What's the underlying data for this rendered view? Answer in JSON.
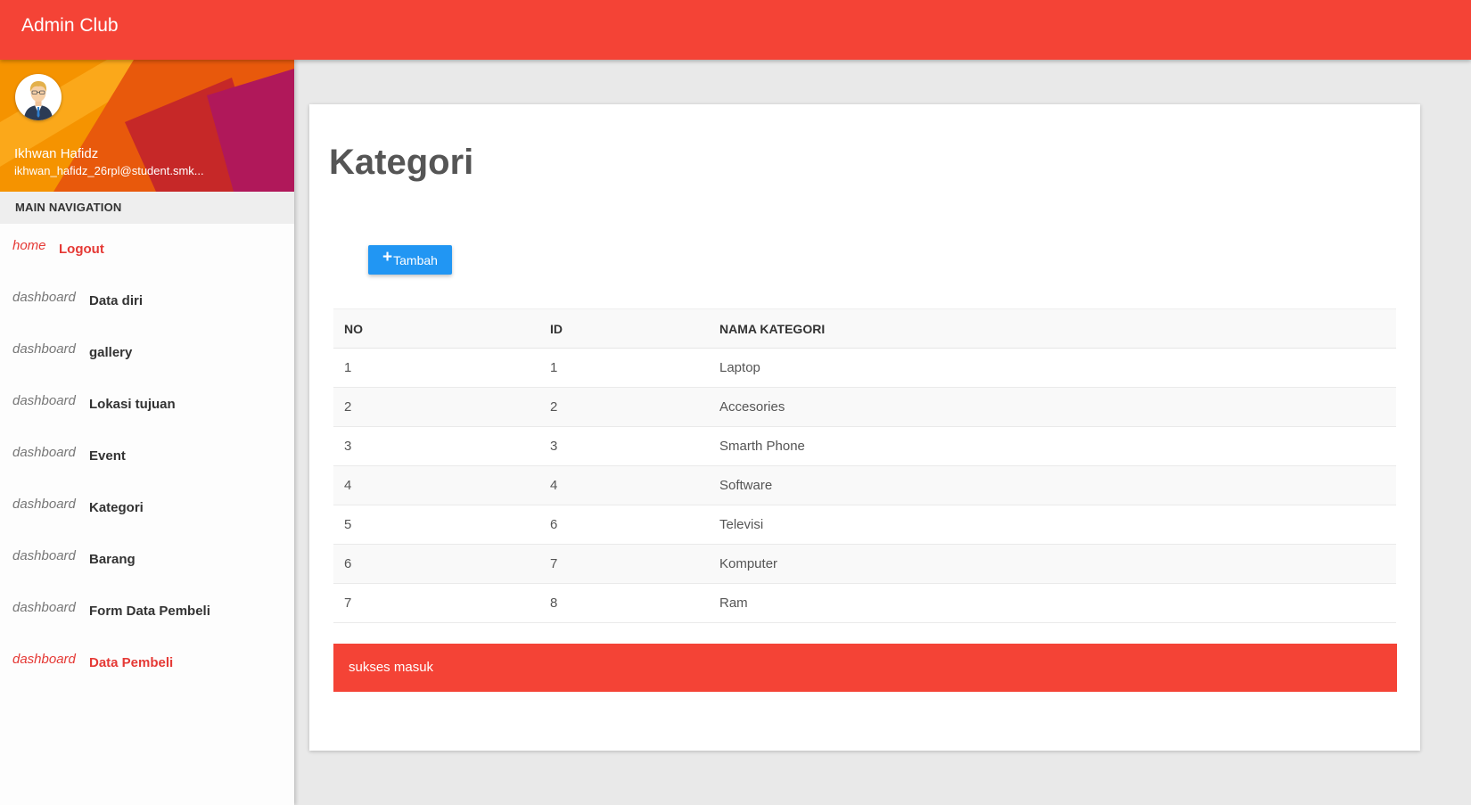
{
  "header": {
    "brand": "Admin Club"
  },
  "user": {
    "name": "Ikhwan Hafidz",
    "email": "ikhwan_hafidz_26rpl@student.smk..."
  },
  "sidebar": {
    "nav_header": "MAIN NAVIGATION",
    "items": [
      {
        "icon": "home",
        "label": "Logout"
      },
      {
        "icon": "dashboard",
        "label": "Data diri"
      },
      {
        "icon": "dashboard",
        "label": "gallery"
      },
      {
        "icon": "dashboard",
        "label": "Lokasi tujuan"
      },
      {
        "icon": "dashboard",
        "label": "Event"
      },
      {
        "icon": "dashboard",
        "label": "Kategori"
      },
      {
        "icon": "dashboard",
        "label": "Barang"
      },
      {
        "icon": "dashboard",
        "label": "Form Data Pembeli"
      },
      {
        "icon": "dashboard",
        "label": "Data Pembeli"
      }
    ]
  },
  "main": {
    "title": "Kategori",
    "add_button": {
      "icon": "+",
      "label": "Tambah"
    },
    "table": {
      "headers": [
        "NO",
        "ID",
        "NAMA KATEGORI"
      ],
      "rows": [
        [
          "1",
          "1",
          "Laptop"
        ],
        [
          "2",
          "2",
          "Accesories"
        ],
        [
          "3",
          "3",
          "Smarth Phone"
        ],
        [
          "4",
          "4",
          "Software"
        ],
        [
          "5",
          "6",
          "Televisi"
        ],
        [
          "6",
          "7",
          "Komputer"
        ],
        [
          "7",
          "8",
          "Ram"
        ]
      ]
    },
    "alert": "sukses masuk"
  },
  "colors": {
    "header": "#f44336",
    "button": "#2196f3",
    "alert": "#f44336",
    "active_link": "#e53935"
  }
}
